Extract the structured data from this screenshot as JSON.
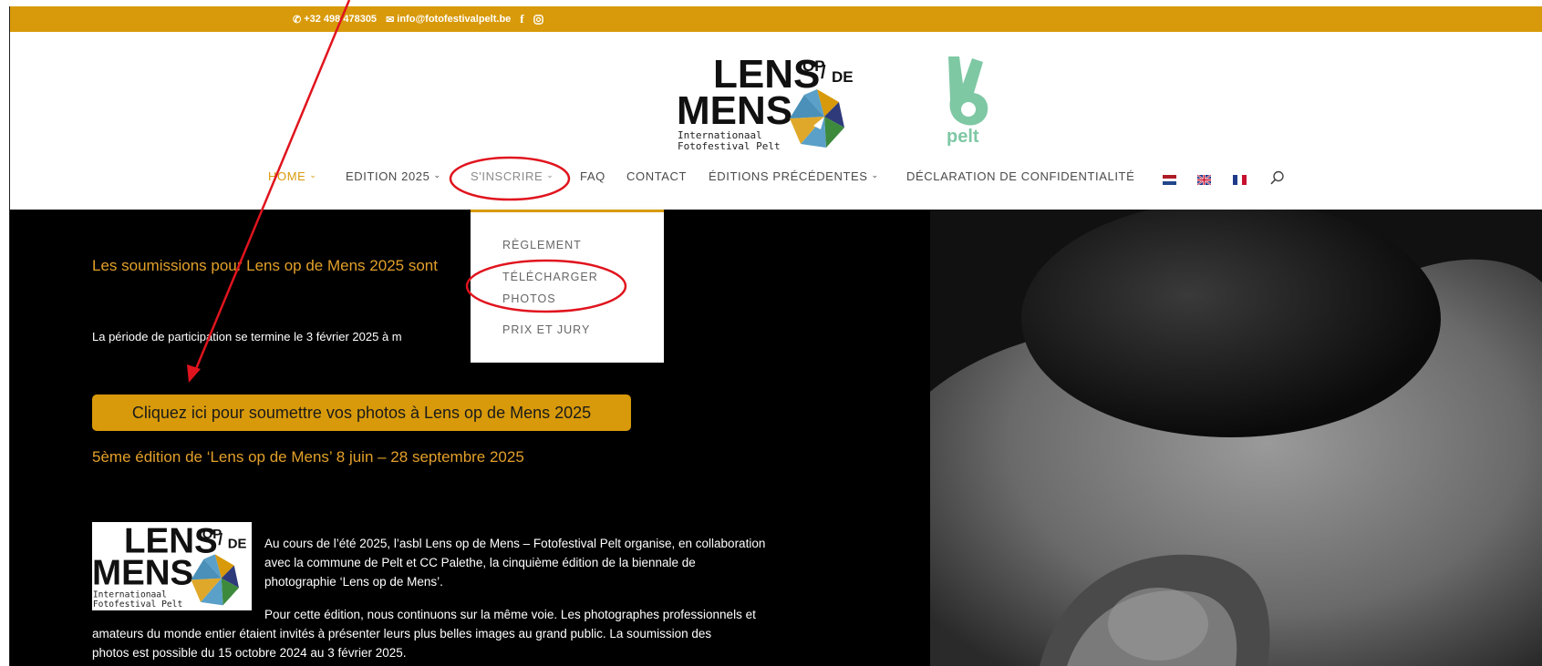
{
  "topbar": {
    "phone": "+32 498 478305",
    "email": "info@fotofestivalpelt.be",
    "facebook_icon": "facebook-icon",
    "instagram_icon": "instagram-icon"
  },
  "logo": {
    "line1": "LENS",
    "op": "OP",
    "de": "DE",
    "line2": "MENS",
    "sub1": "Internationaal",
    "sub2": "Fotofestival Pelt"
  },
  "pelt_logo": {
    "text": "pelt"
  },
  "nav": {
    "items": [
      {
        "label": "HOME",
        "chevron": true
      },
      {
        "label": "EDITION 2025",
        "chevron": true
      },
      {
        "label": "S'INSCRIRE",
        "chevron": true
      },
      {
        "label": "FAQ",
        "chevron": false
      },
      {
        "label": "CONTACT",
        "chevron": false
      },
      {
        "label": "ÉDITIONS PRÉCÉDENTES",
        "chevron": true
      },
      {
        "label": "DÉCLARATION DE CONFIDENTIALITÉ",
        "chevron": false
      }
    ],
    "flags": [
      "flag-nl-icon",
      "flag-uk-icon",
      "flag-fr-icon"
    ],
    "search_icon": "search-icon"
  },
  "dropdown": {
    "items": [
      "RÈGLEMENT",
      "TÉLÉCHARGER",
      "PHOTOS",
      "PRIX ET JURY"
    ]
  },
  "hero": {
    "heading1": "Les soumissions pour Lens op de Mens 2025 sont",
    "period": "La période de participation se termine le 3 février 2025 à m",
    "cta": "Cliquez ici pour soumettre vos photos à Lens op de Mens 2025",
    "heading2": "5ème édition de ‘Lens op de Mens’ 8 juin – 28 septembre 2025",
    "para1_line1": "Au cours de l’été 2025, l’asbl Lens op de Mens – Fotofestival Pelt organise, en collaboration",
    "para1_line2": "avec la commune de Pelt et CC Palethe, la cinquième édition de la biennale de",
    "para1_line3": "photographie ‘Lens op de Mens’.",
    "para2_line1": "Pour cette édition, nous continuons sur la même voie. Les photographes professionnels et",
    "para2_line2": "amateurs du monde entier étaient invités à présenter leurs plus belles images au grand public. La soumission des",
    "para2_line3": "photos est possible du 15 octobre 2024 au 3 février 2025."
  },
  "colors": {
    "accent": "#d89a0a",
    "annotation": "#e0141e"
  }
}
